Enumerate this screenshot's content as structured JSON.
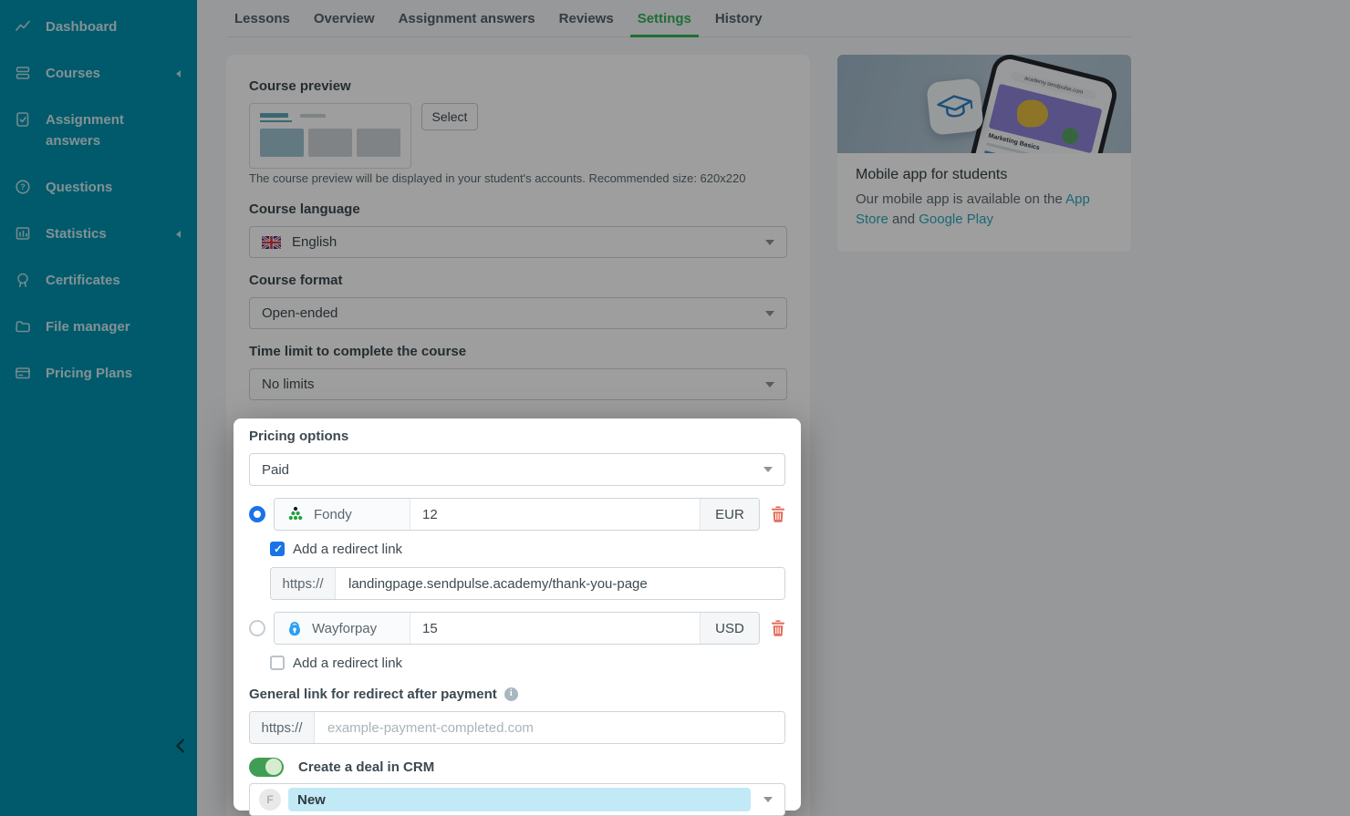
{
  "sidebar": {
    "items": [
      {
        "label": "Dashboard",
        "icon": "chart-line-icon",
        "has_submenu": false
      },
      {
        "label": "Courses",
        "icon": "courses-icon",
        "has_submenu": true
      },
      {
        "label": "Assignment answers",
        "icon": "assignment-icon",
        "has_submenu": false
      },
      {
        "label": "Questions",
        "icon": "question-icon",
        "has_submenu": false
      },
      {
        "label": "Statistics",
        "icon": "statistics-icon",
        "has_submenu": true
      },
      {
        "label": "Certificates",
        "icon": "certificate-icon",
        "has_submenu": false
      },
      {
        "label": "File manager",
        "icon": "folder-icon",
        "has_submenu": false
      },
      {
        "label": "Pricing Plans",
        "icon": "pricing-card-icon",
        "has_submenu": false
      }
    ],
    "collapse_icon": "chevron-left-icon"
  },
  "tabs": [
    {
      "label": "Lessons",
      "active": false
    },
    {
      "label": "Overview",
      "active": false
    },
    {
      "label": "Assignment answers",
      "active": false
    },
    {
      "label": "Reviews",
      "active": false
    },
    {
      "label": "Settings",
      "active": true
    },
    {
      "label": "History",
      "active": false
    }
  ],
  "form": {
    "course_preview": {
      "label": "Course preview",
      "select_button": "Select",
      "helper": "The course preview will be displayed in your student's accounts. Recommended size: 620x220"
    },
    "course_language": {
      "label": "Course language",
      "value": "English",
      "flag": "uk-flag-icon"
    },
    "course_format": {
      "label": "Course format",
      "value": "Open-ended"
    },
    "time_limit": {
      "label": "Time limit to complete the course",
      "value": "No limits"
    },
    "pricing": {
      "label": "Pricing options",
      "type_value": "Paid",
      "methods": [
        {
          "name": "Fondy",
          "icon": "fondy-logo-icon",
          "price": "12",
          "currency": "EUR",
          "selected": true,
          "redirect_label": "Add a redirect link",
          "redirect_checked": true,
          "url_prefix": "https://",
          "url_value": "landingpage.sendpulse.academy/thank-you-page"
        },
        {
          "name": "Wayforpay",
          "icon": "wayforpay-logo-icon",
          "price": "15",
          "currency": "USD",
          "selected": false,
          "redirect_label": "Add a redirect link",
          "redirect_checked": false
        }
      ],
      "general_link": {
        "label": "General link for redirect after payment",
        "info_icon": "info-icon",
        "prefix": "https://",
        "placeholder": "example-payment-completed.com"
      },
      "crm": {
        "toggle_on": true,
        "label": "Create a deal in CRM",
        "avatar_letter": "F",
        "value": "New"
      }
    }
  },
  "mobile_card": {
    "title": "Mobile app for students",
    "text_before": "Our mobile app is available on the ",
    "link_app_store": "App Store",
    "text_middle": " and ",
    "link_google_play": "Google Play",
    "phone_url": "academy.sendpulse.com",
    "phone_banner_title": "Marketing Basics"
  },
  "colors": {
    "sidebar_bg": "#0091ad",
    "accent_green": "#33b257",
    "radio_checkbox_blue": "#1a73e8",
    "toggle_green": "#3f9e54",
    "crm_pill_blue": "#c2e9f6",
    "trash_red": "#e4705e",
    "link_teal": "#2ba7bd",
    "overlay": "rgba(0,0,0,0.38)"
  }
}
